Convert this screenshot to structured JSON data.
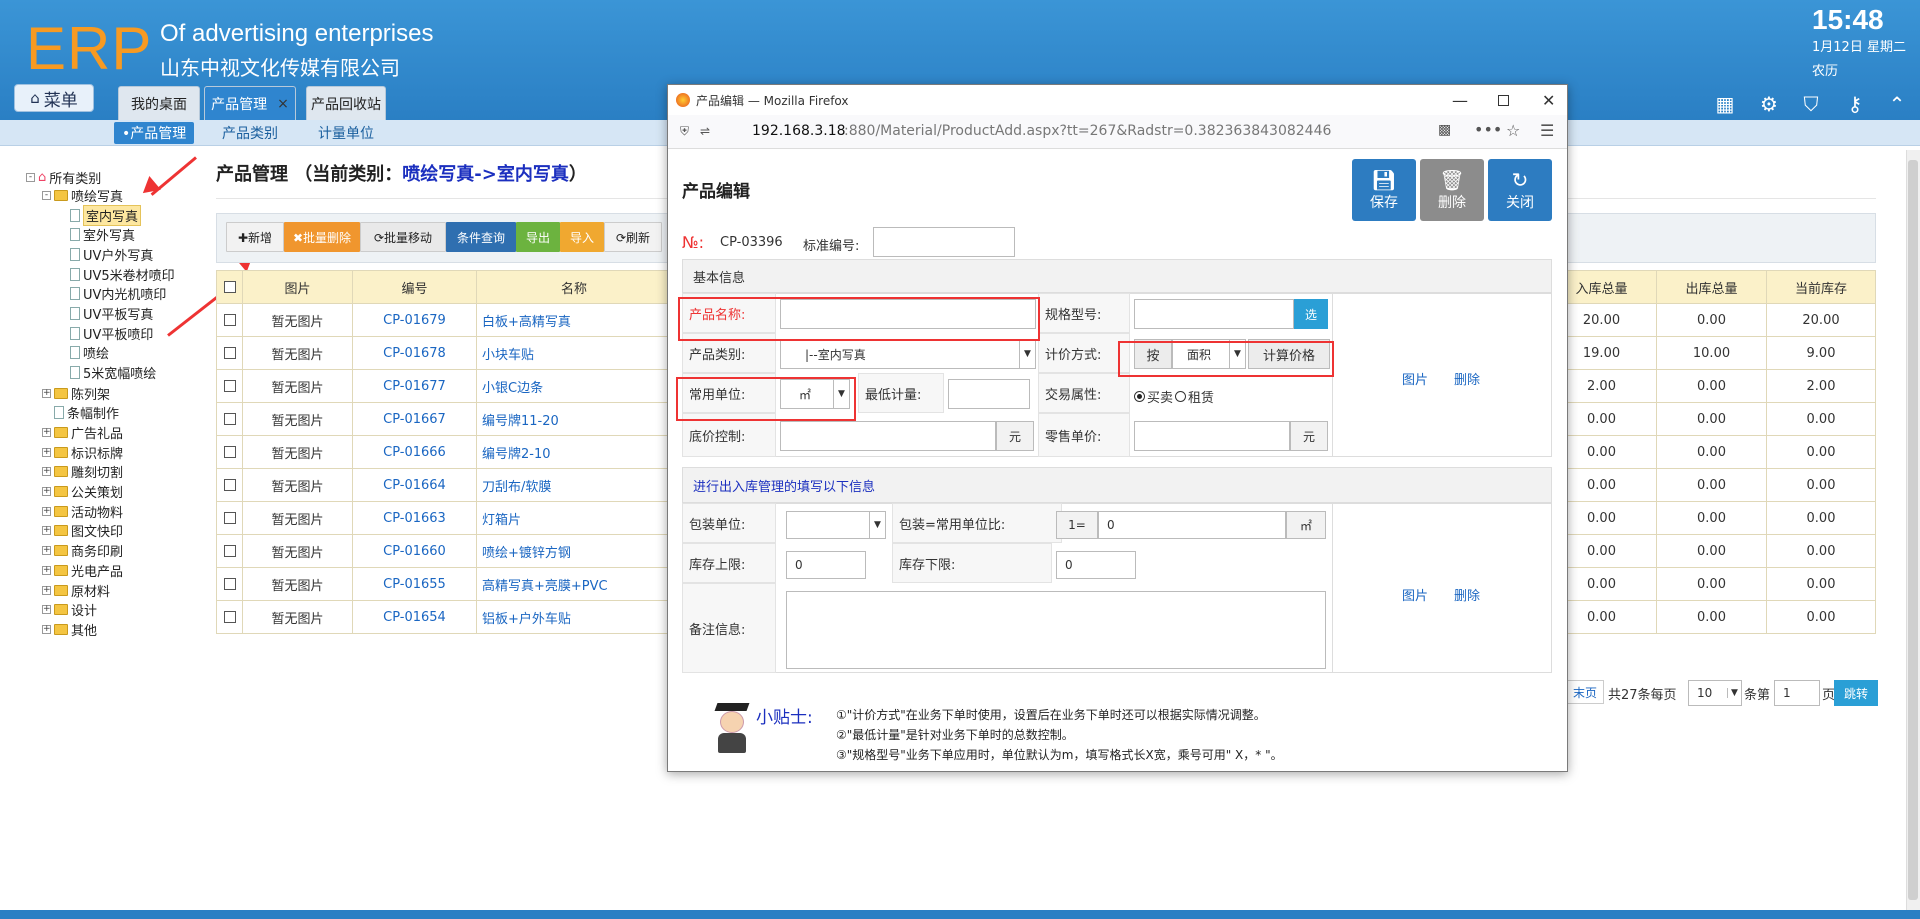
{
  "header": {
    "logo": "ERP",
    "title": "Of advertising enterprises",
    "subtitle": "山东中视文化传媒有限公司",
    "time": "15:48",
    "date": "1月12日 星期二",
    "lunar": "农历"
  },
  "menu_button": "菜单",
  "tabs": [
    {
      "label": "我的桌面"
    },
    {
      "label": "产品管理",
      "close": "×"
    },
    {
      "label": "产品回收站"
    }
  ],
  "subnav": [
    "•产品管理",
    "产品类别",
    "计量单位"
  ],
  "tree": {
    "root": "所有类别",
    "expanded": "喷绘写真",
    "children": [
      "室内写真",
      "室外写真",
      "UV户外写真",
      "UV5米卷材喷印",
      "UV内光机喷印",
      "UV平板写真",
      "UV平板喷印",
      "喷绘",
      "5米宽幅喷绘"
    ],
    "others": [
      "陈列架",
      "条幅制作",
      "广告礼品",
      "标识标牌",
      "雕刻切割",
      "公关策划",
      "活动物料",
      "图文快印",
      "商务印刷",
      "光电产品",
      "原材料",
      "设计",
      "其他"
    ]
  },
  "page_title": "产品管理",
  "page_title_current_prefix": "（当前类别：",
  "page_title_current": "喷绘写真->室内写真",
  "page_title_suffix": "）",
  "toolbar": {
    "add": "✚新增",
    "batch_delete": "✖批量删除",
    "batch_move": "⟳批量移动",
    "query": "条件查询",
    "export": "导出",
    "import": "导入",
    "refresh": "⟳刷新"
  },
  "colors": {
    "header": "#2f85cf",
    "logo": "#f79a22",
    "btn_delete": "#f0962e",
    "btn_move": "#e9e9e9",
    "btn_query": "#2f6fb0",
    "btn_export": "#6cb33f",
    "btn_import": "#f0a830",
    "link": "#1a66c2",
    "highlight": "#e33333"
  },
  "table": {
    "headers_left": [
      "图片",
      "编号",
      "名称"
    ],
    "headers_right": [
      "入库总量",
      "出库总量",
      "当前库存"
    ],
    "rows": [
      {
        "pic": "暂无图片",
        "code": "CP-01679",
        "name": "白板+高精写真",
        "in": "20.00",
        "out": "0.00",
        "stock": "20.00"
      },
      {
        "pic": "暂无图片",
        "code": "CP-01678",
        "name": "小块车贴",
        "in": "19.00",
        "out": "10.00",
        "stock": "9.00"
      },
      {
        "pic": "暂无图片",
        "code": "CP-01677",
        "name": "小银C边条",
        "in": "2.00",
        "out": "0.00",
        "stock": "2.00"
      },
      {
        "pic": "暂无图片",
        "code": "CP-01667",
        "name": "编号牌11-20",
        "in": "0.00",
        "out": "0.00",
        "stock": "0.00"
      },
      {
        "pic": "暂无图片",
        "code": "CP-01666",
        "name": "编号牌2-10",
        "in": "0.00",
        "out": "0.00",
        "stock": "0.00"
      },
      {
        "pic": "暂无图片",
        "code": "CP-01664",
        "name": "刀刮布/软膜",
        "in": "0.00",
        "out": "0.00",
        "stock": "0.00"
      },
      {
        "pic": "暂无图片",
        "code": "CP-01663",
        "name": "灯箱片",
        "in": "0.00",
        "out": "0.00",
        "stock": "0.00"
      },
      {
        "pic": "暂无图片",
        "code": "CP-01660",
        "name": "喷绘+镀锌方钢",
        "in": "0.00",
        "out": "0.00",
        "stock": "0.00"
      },
      {
        "pic": "暂无图片",
        "code": "CP-01655",
        "name": "高精写真+亮膜+PVC",
        "in": "0.00",
        "out": "0.00",
        "stock": "0.00"
      },
      {
        "pic": "暂无图片",
        "code": "CP-01654",
        "name": "铝板+户外车贴",
        "in": "0.00",
        "out": "0.00",
        "stock": "0.00"
      }
    ]
  },
  "pager": {
    "last": "末页",
    "total": "共27条每页",
    "per_page": "10",
    "unit": "条第",
    "page": "1",
    "page_unit": "页",
    "go": "跳转"
  },
  "modal": {
    "window_title": "产品编辑 — Mozilla Firefox",
    "url_host": "192.168.3.18",
    "url_rest": ":880/Material/ProductAdd.aspx?tt=267&Radstr=0.382363843082446",
    "heading": "产品编辑",
    "buttons": {
      "save": "保存",
      "delete": "删除",
      "close": "关闭"
    },
    "no_label": "№:",
    "no_value": "CP-03396",
    "std_label": "标准编号:",
    "section_basic": "基本信息",
    "name_label": "产品名称:",
    "spec_label": "规格型号:",
    "spec_btn": "选",
    "category_label": "产品类别:",
    "category_value": "|--室内写真",
    "pricing_label": "计价方式:",
    "pricing_by": "按",
    "pricing_value": "面积",
    "pricing_btn": "计算价格",
    "unit_label": "常用单位:",
    "unit_value": "㎡",
    "min_label": "最低计量:",
    "trade_label": "交易属性:",
    "trade_sell": "买卖",
    "trade_rent": "租赁",
    "floor_label": "底价控制:",
    "yuan": "元",
    "retail_label": "零售单价:",
    "pic_link": "图片",
    "del_link": "删除",
    "section_stock": "进行出入库管理的填写以下信息",
    "pack_label": "包装单位:",
    "ratio_label": "包装=常用单位比:",
    "ratio_prefix": "1=",
    "ratio_value": "0",
    "ratio_unit": "㎡",
    "upper_label": "库存上限:",
    "upper_value": "0",
    "lower_label": "库存下限:",
    "lower_value": "0",
    "remark_label": "备注信息:",
    "tip_title": "小贴士:",
    "tips": [
      "①\"计价方式\"在业务下单时使用，设置后在业务下单时还可以根据实际情况调整。",
      "②\"最低计量\"是针对业务下单时的总数控制。",
      "③\"规格型号\"业务下单应用时，单位默认为m，填写格式长X宽，乘号可用\" X，* \"。"
    ]
  }
}
